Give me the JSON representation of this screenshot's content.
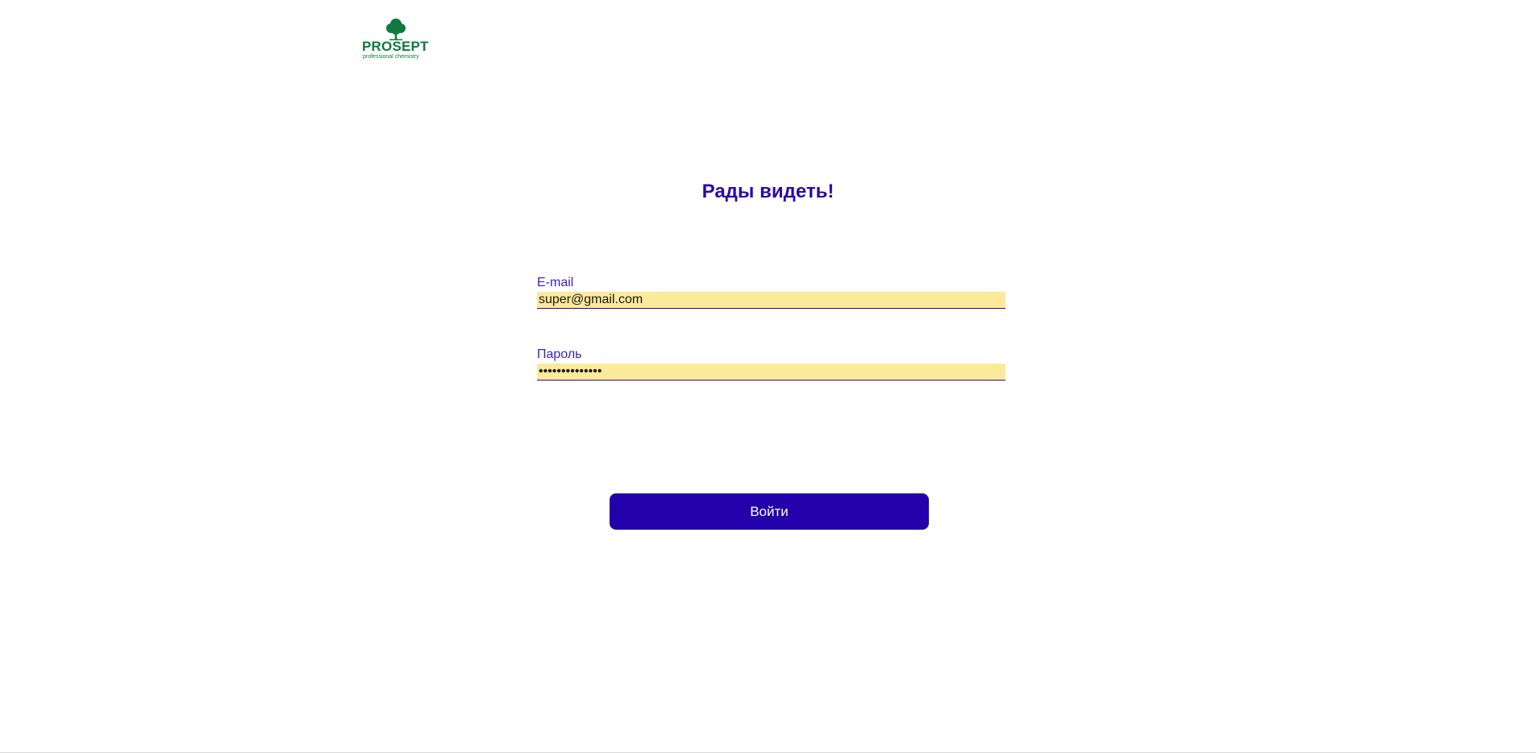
{
  "logo": {
    "brand": "PROSEPT",
    "tagline": "professional chemistry",
    "color": "#0e7a3c"
  },
  "heading": "Рады видеть!",
  "form": {
    "email": {
      "label": "E-mail",
      "value": "super@gmail.com"
    },
    "password": {
      "label": "Пароль",
      "value": "••••••••••••••"
    },
    "submit_label": "Войти"
  },
  "colors": {
    "accent": "#2200aa",
    "input_fill": "#fde99a",
    "label": "#3c1fc0"
  }
}
